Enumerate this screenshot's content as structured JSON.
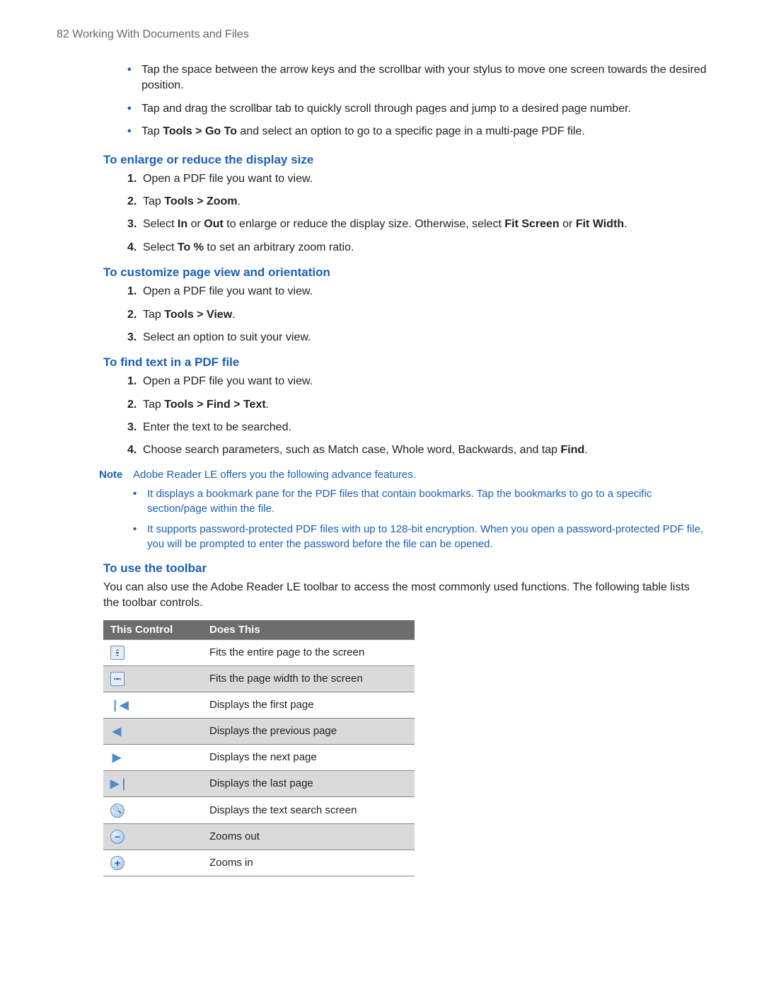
{
  "header": {
    "page_number": "82",
    "chapter": "Working With Documents and Files"
  },
  "intro_bullets": [
    {
      "text": "Tap the space between the arrow keys and the scrollbar with your stylus to move one screen towards the desired position."
    },
    {
      "text": "Tap and drag the scrollbar tab to quickly scroll through pages and jump to a desired page number."
    },
    {
      "pre": "Tap ",
      "bold": "Tools > Go To",
      "post": " and select an option to go to a specific page in a multi-page PDF file."
    }
  ],
  "sec1": {
    "title": "To enlarge or reduce the display size",
    "steps": [
      {
        "text": "Open a PDF file you want to view."
      },
      {
        "pre": "Tap ",
        "bold": "Tools > Zoom",
        "post": "."
      },
      {
        "pre": "Select ",
        "bold1": "In",
        "mid1": " or ",
        "bold2": "Out",
        "mid2": " to enlarge or reduce the display size. Otherwise, select ",
        "bold3": "Fit Screen",
        "mid3": " or ",
        "bold4": "Fit Width",
        "post": "."
      },
      {
        "pre": "Select ",
        "bold": "To %",
        "post": " to set an arbitrary zoom ratio."
      }
    ]
  },
  "sec2": {
    "title": "To customize page view and orientation",
    "steps": [
      {
        "text": "Open a PDF file you want to view."
      },
      {
        "pre": "Tap ",
        "bold": "Tools > View",
        "post": "."
      },
      {
        "text": "Select an option to suit your view."
      }
    ]
  },
  "sec3": {
    "title": "To find text in a PDF file",
    "steps": [
      {
        "text": "Open a PDF file you want to view."
      },
      {
        "pre": "Tap ",
        "bold": "Tools > Find > Text",
        "post": "."
      },
      {
        "text": "Enter the text to be searched."
      },
      {
        "pre": "Choose search parameters, such as Match case, Whole word, Backwards, and tap ",
        "bold": "Find",
        "post": "."
      }
    ]
  },
  "note": {
    "label": "Note",
    "lead": "Adobe Reader LE offers you the following advance features.",
    "bullets": [
      "It displays a bookmark pane for the PDF files that contain bookmarks. Tap the bookmarks to go to a specific section/page within the file.",
      "It supports password-protected PDF files with up to 128-bit encryption. When you open a password-protected PDF file, you will be prompted to enter the password before the file can be opened."
    ]
  },
  "sec4": {
    "title": "To use the toolbar",
    "para": "You can also use the Adobe Reader LE toolbar to access the most commonly used functions. The following table lists the toolbar controls.",
    "col1": "This Control",
    "col2": "Does This",
    "rows": [
      {
        "desc": "Fits the entire page to the screen"
      },
      {
        "desc": "Fits the page width to the screen"
      },
      {
        "desc": "Displays the first page"
      },
      {
        "desc": "Displays the previous page"
      },
      {
        "desc": "Displays the next page"
      },
      {
        "desc": "Displays the last page"
      },
      {
        "desc": "Displays the text search screen"
      },
      {
        "desc": "Zooms out"
      },
      {
        "desc": "Zooms in"
      }
    ]
  }
}
